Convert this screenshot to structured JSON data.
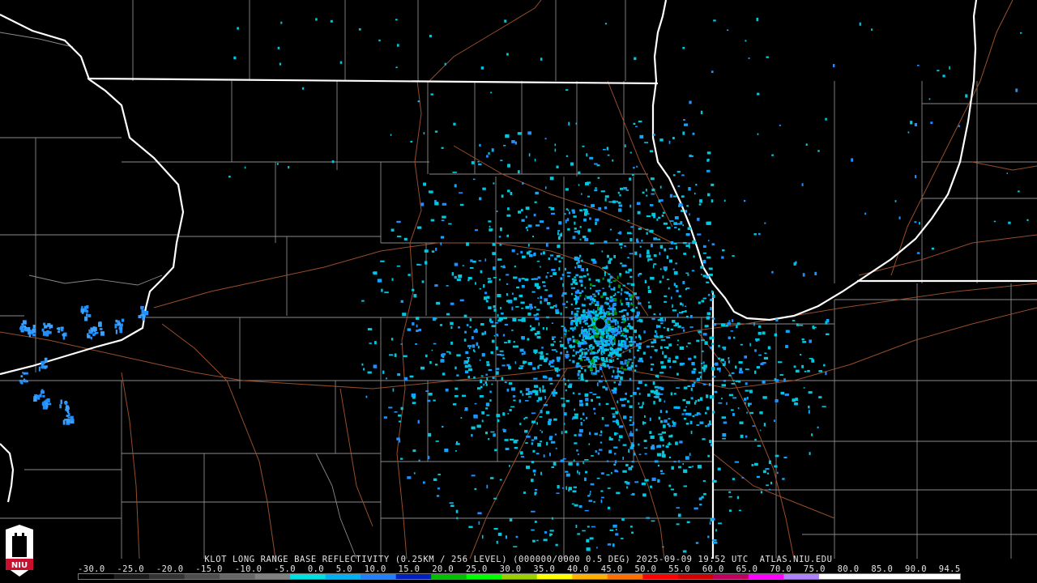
{
  "caption": {
    "text": "KLOT LONG RANGE BASE REFLECTIVITY (0.25KM / 256 LEVEL) (000000/0000 0.5 DEG) 2025-09-09 19:52 UTC  ATLAS.NIU.EDU"
  },
  "scale": {
    "ticks": [
      "-30.0",
      "-25.0",
      "-20.0",
      "-15.0",
      "-10.0",
      "-5.0",
      "0.0",
      "5.0",
      "10.0",
      "15.0",
      "20.0",
      "25.0",
      "30.0",
      "35.0",
      "40.0",
      "45.0",
      "50.0",
      "55.0",
      "60.0",
      "65.0",
      "70.0",
      "75.0",
      "80.0",
      "85.0",
      "90.0",
      "94.5"
    ],
    "colors": [
      "#000000",
      "#1a1a1a",
      "#333333",
      "#4d4d4d",
      "#666666",
      "#808080",
      "#00e0e0",
      "#00b0f0",
      "#2080ff",
      "#0020c0",
      "#00c000",
      "#00ff00",
      "#9bd000",
      "#ffff00",
      "#ffb000",
      "#ff7000",
      "#ff0000",
      "#d00000",
      "#c00060",
      "#ff00ff",
      "#b080ff",
      "#ffffff",
      "#ffffff",
      "#ffffff",
      "#ffffff"
    ]
  },
  "logo": {
    "text": "NIU",
    "colors": {
      "red": "#c8102e",
      "white": "#ffffff"
    }
  },
  "colors": {
    "state_line": "#ffffff",
    "county_line": "#8a8a8a",
    "highway": "#a0522d",
    "echo_light": "#00c8e0",
    "echo_mid": "#2090ff",
    "echo_core": "#008c00"
  }
}
